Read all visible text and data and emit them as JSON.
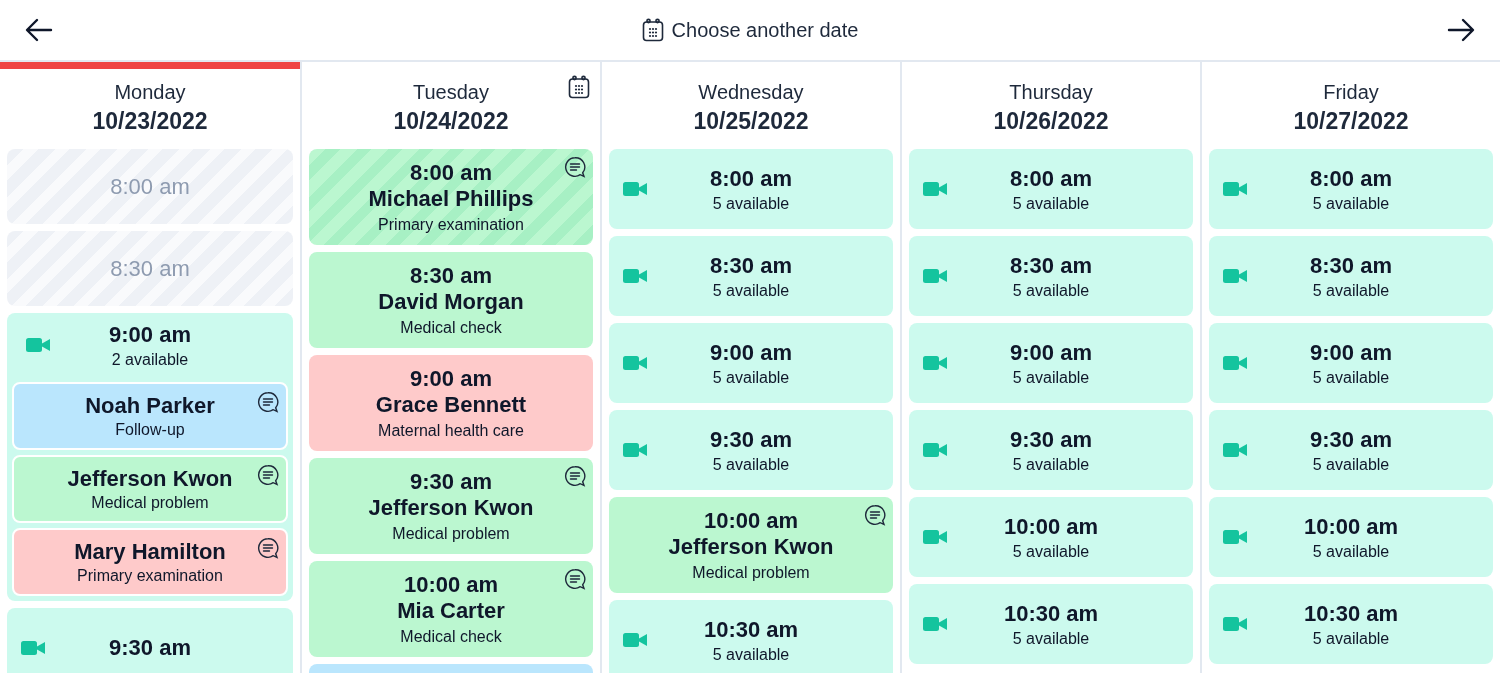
{
  "toolbar": {
    "title": "Choose another date"
  },
  "days": [
    {
      "day": "Monday",
      "date": "10/23/2022",
      "today": true,
      "picker": false,
      "slots": [
        {
          "kind": "blocked",
          "time": "8:00 am"
        },
        {
          "kind": "blocked",
          "time": "8:30 am"
        },
        {
          "kind": "open",
          "time": "9:00 am",
          "available": "2 available",
          "bookings": [
            {
              "name": "Noah Parker",
              "reason": "Follow-up",
              "color": "#bae6fd",
              "note": true
            },
            {
              "name": "Jefferson Kwon",
              "reason": "Medical problem",
              "color": "#bbf7d0",
              "note": true
            },
            {
              "name": "Mary Hamilton",
              "reason": "Primary examination",
              "color": "#fecaca",
              "note": true
            }
          ]
        },
        {
          "kind": "open",
          "time": "9:30 am"
        }
      ]
    },
    {
      "day": "Tuesday",
      "date": "10/24/2022",
      "today": false,
      "picker": true,
      "slots": [
        {
          "kind": "booking",
          "time": "8:00 am",
          "name": "Michael Phillips",
          "reason": "Primary examination",
          "color": "#bbf7d0",
          "striped": true,
          "note": true
        },
        {
          "kind": "booking",
          "time": "8:30 am",
          "name": "David Morgan",
          "reason": "Medical check",
          "color": "#bbf7d0",
          "striped": false,
          "note": false
        },
        {
          "kind": "booking",
          "time": "9:00 am",
          "name": "Grace Bennett",
          "reason": "Maternal health care",
          "color": "#fecaca",
          "striped": false,
          "note": false
        },
        {
          "kind": "booking",
          "time": "9:30 am",
          "name": "Jefferson Kwon",
          "reason": "Medical problem",
          "color": "#bbf7d0",
          "striped": false,
          "note": true
        },
        {
          "kind": "booking",
          "time": "10:00 am",
          "name": "Mia Carter",
          "reason": "Medical check",
          "color": "#bbf7d0",
          "striped": false,
          "note": true
        },
        {
          "kind": "booking",
          "color": "#bae6fd",
          "striped": false,
          "note": false
        }
      ]
    },
    {
      "day": "Wednesday",
      "date": "10/25/2022",
      "today": false,
      "picker": false,
      "slots": [
        {
          "kind": "open",
          "time": "8:00 am",
          "available": "5 available"
        },
        {
          "kind": "open",
          "time": "8:30 am",
          "available": "5 available"
        },
        {
          "kind": "open",
          "time": "9:00 am",
          "available": "5 available"
        },
        {
          "kind": "open",
          "time": "9:30 am",
          "available": "5 available"
        },
        {
          "kind": "booking",
          "time": "10:00 am",
          "name": "Jefferson Kwon",
          "reason": "Medical problem",
          "color": "#bbf7d0",
          "striped": false,
          "note": true
        },
        {
          "kind": "open",
          "time": "10:30 am",
          "available": "5 available"
        }
      ]
    },
    {
      "day": "Thursday",
      "date": "10/26/2022",
      "today": false,
      "picker": false,
      "slots": [
        {
          "kind": "open",
          "time": "8:00 am",
          "available": "5 available"
        },
        {
          "kind": "open",
          "time": "8:30 am",
          "available": "5 available"
        },
        {
          "kind": "open",
          "time": "9:00 am",
          "available": "5 available"
        },
        {
          "kind": "open",
          "time": "9:30 am",
          "available": "5 available"
        },
        {
          "kind": "open",
          "time": "10:00 am",
          "available": "5 available"
        },
        {
          "kind": "open",
          "time": "10:30 am",
          "available": "5 available"
        }
      ]
    },
    {
      "day": "Friday",
      "date": "10/27/2022",
      "today": false,
      "picker": false,
      "slots": [
        {
          "kind": "open",
          "time": "8:00 am",
          "available": "5 available"
        },
        {
          "kind": "open",
          "time": "8:30 am",
          "available": "5 available"
        },
        {
          "kind": "open",
          "time": "9:00 am",
          "available": "5 available"
        },
        {
          "kind": "open",
          "time": "9:30 am",
          "available": "5 available"
        },
        {
          "kind": "open",
          "time": "10:00 am",
          "available": "5 available"
        },
        {
          "kind": "open",
          "time": "10:30 am",
          "available": "5 available"
        }
      ]
    }
  ]
}
